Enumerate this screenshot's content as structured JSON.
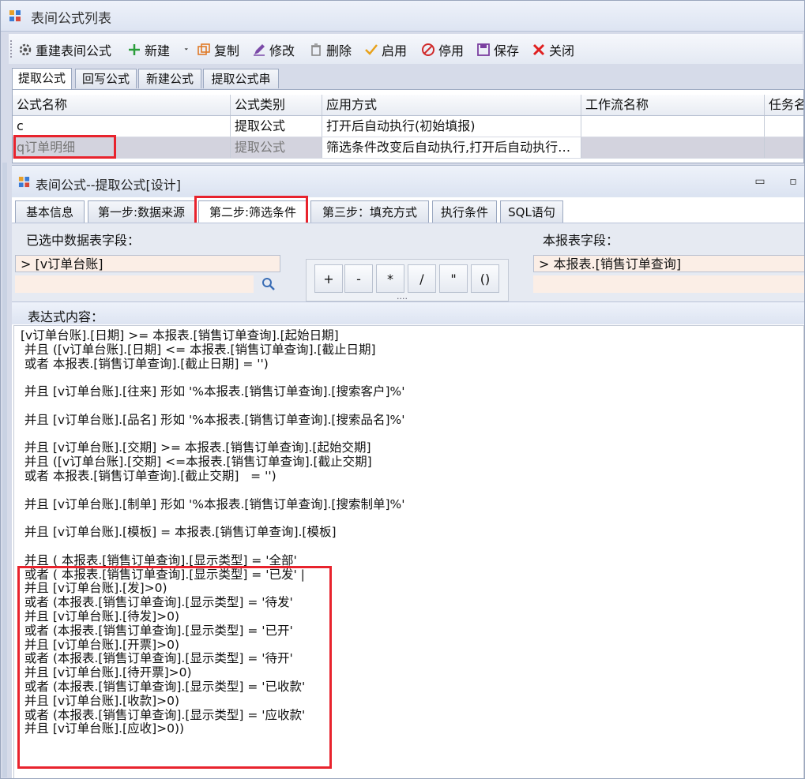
{
  "window": {
    "title": "表间公式列表"
  },
  "toolbar": {
    "rebuild": "重建表间公式",
    "new": "新建",
    "copy": "复制",
    "edit": "修改",
    "delete": "删除",
    "enable": "启用",
    "disable": "停用",
    "save": "保存",
    "close": "关闭"
  },
  "tabs": [
    "提取公式",
    "回写公式",
    "新建公式",
    "提取公式串"
  ],
  "grid": {
    "columns": [
      "公式名称",
      "公式类别",
      "应用方式",
      "工作流名称",
      "任务名"
    ],
    "rows": [
      [
        "c",
        "提取公式",
        "打开后自动执行(初始填报)",
        "",
        ""
      ],
      [
        "q订单明细",
        "提取公式",
        "筛选条件改变后自动执行,打开后自动执行…",
        "",
        ""
      ]
    ]
  },
  "designer": {
    "title": "表间公式--提取公式[设计]",
    "minimize": "▭",
    "restore": "▫",
    "tabs": [
      "基本信息",
      "第一步:数据来源",
      "第二步:筛选条件",
      "第三步：填充方式",
      "执行条件",
      "SQL语句"
    ],
    "selected_fields_label": "已选中数据表字段：",
    "selected_fields_tree": "[v订单台账]",
    "report_fields_label": "本报表字段：",
    "report_fields_tree": "本报表.[销售订单查询]",
    "calc_buttons": [
      "+",
      "-",
      "*",
      "/",
      "\"",
      "()"
    ],
    "calc_more": "....",
    "expr_label": "表达式内容：",
    "expression": "[v订单台账].[日期] >= 本报表.[销售订单查询].[起始日期]\n 并且 ([v订单台账].[日期] <= 本报表.[销售订单查询].[截止日期]\n 或者 本报表.[销售订单查询].[截止日期] = '')\n\n 并且 [v订单台账].[往来] 形如 '%本报表.[销售订单查询].[搜索客户]%'\n\n 并且 [v订单台账].[品名] 形如 '%本报表.[销售订单查询].[搜索品名]%'\n\n 并且 [v订单台账].[交期] >= 本报表.[销售订单查询].[起始交期]\n 并且 ([v订单台账].[交期] <=本报表.[销售订单查询].[截止交期]\n 或者 本报表.[销售订单查询].[截止交期]   = '')\n\n 并且 [v订单台账].[制单] 形如 '%本报表.[销售订单查询].[搜索制单]%'\n\n 并且 [v订单台账].[模板] = 本报表.[销售订单查询].[模板]\n\n 并且 ( 本报表.[销售订单查询].[显示类型] = '全部'\n 或者 ( 本报表.[销售订单查询].[显示类型] = '已发' |\n 并且 [v订单台账].[发]>0)\n 或者 (本报表.[销售订单查询].[显示类型] = '待发'\n 并且 [v订单台账].[待发]>0)\n 或者 (本报表.[销售订单查询].[显示类型] = '已开'\n 并且 [v订单台账].[开票]>0)\n 或者 (本报表.[销售订单查询].[显示类型] = '待开'\n 并且 [v订单台账].[待开票]>0)\n 或者 (本报表.[销售订单查询].[显示类型] = '已收款'\n 并且 [v订单台账].[收款]>0)\n 或者 (本报表.[销售订单查询].[显示类型] = '应收款'\n 并且 [v订单台账].[应收]>0))"
  },
  "colors": {
    "highlight_red": "#e8232d",
    "window_bg": "#d6dbe9"
  }
}
